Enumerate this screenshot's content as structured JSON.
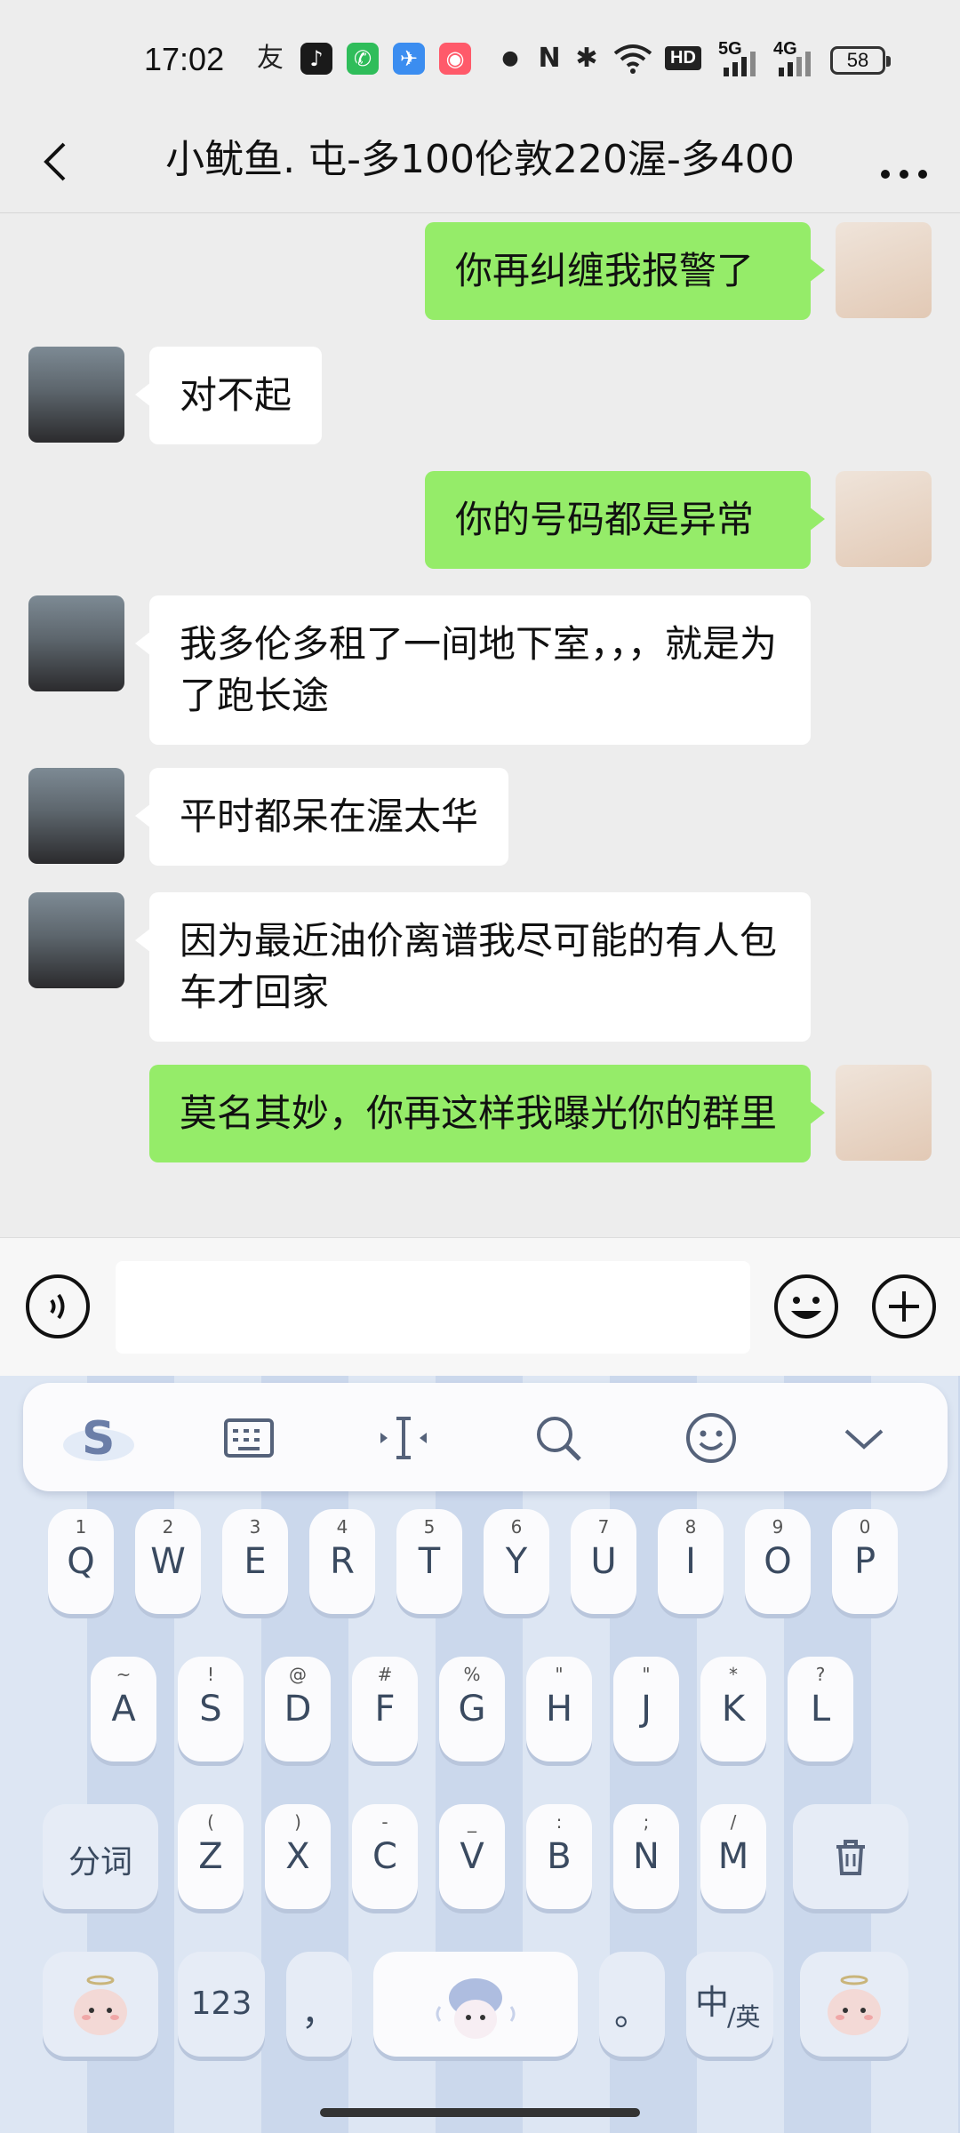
{
  "status_bar": {
    "time": "17:02",
    "battery": "58",
    "network_5g": "5G",
    "network_4g": "4G",
    "hd": "HD"
  },
  "navbar": {
    "title": "小鱿鱼. 屯-多100伦敦220渥-多400"
  },
  "messages": [
    {
      "from": "me",
      "text": "你再纠缠我报警了"
    },
    {
      "from": "them",
      "text": "对不起"
    },
    {
      "from": "me",
      "text": "你的号码都是异常"
    },
    {
      "from": "them",
      "text": "我多伦多租了一间地下室，，，就是为了跑长途"
    },
    {
      "from": "them",
      "text": "平时都呆在渥太华"
    },
    {
      "from": "them",
      "text": "因为最近油价离谱我尽可能的有人包车才回家"
    },
    {
      "from": "me",
      "text": "莫名其妙，你再这样我曝光你的群里"
    }
  ],
  "input": {
    "value": ""
  },
  "keyboard": {
    "row1": [
      {
        "main": "Q",
        "sub": "1"
      },
      {
        "main": "W",
        "sub": "2"
      },
      {
        "main": "E",
        "sub": "3"
      },
      {
        "main": "R",
        "sub": "4"
      },
      {
        "main": "T",
        "sub": "5"
      },
      {
        "main": "Y",
        "sub": "6"
      },
      {
        "main": "U",
        "sub": "7"
      },
      {
        "main": "I",
        "sub": "8"
      },
      {
        "main": "O",
        "sub": "9"
      },
      {
        "main": "P",
        "sub": "0"
      }
    ],
    "row2": [
      {
        "main": "A",
        "sub": "~"
      },
      {
        "main": "S",
        "sub": "!"
      },
      {
        "main": "D",
        "sub": "@"
      },
      {
        "main": "F",
        "sub": "#"
      },
      {
        "main": "G",
        "sub": "%"
      },
      {
        "main": "H",
        "sub": "\""
      },
      {
        "main": "J",
        "sub": "\""
      },
      {
        "main": "K",
        "sub": "*"
      },
      {
        "main": "L",
        "sub": "?"
      }
    ],
    "row3": [
      {
        "main": "Z",
        "sub": "("
      },
      {
        "main": "X",
        "sub": ")"
      },
      {
        "main": "C",
        "sub": "-"
      },
      {
        "main": "V",
        "sub": "_"
      },
      {
        "main": "B",
        "sub": ":"
      },
      {
        "main": "N",
        "sub": ";"
      },
      {
        "main": "M",
        "sub": "/"
      }
    ],
    "fenci": "分词",
    "num_key": "123",
    "comma": "，",
    "period": "。",
    "lang_zh": "中",
    "lang_en": "/英"
  }
}
